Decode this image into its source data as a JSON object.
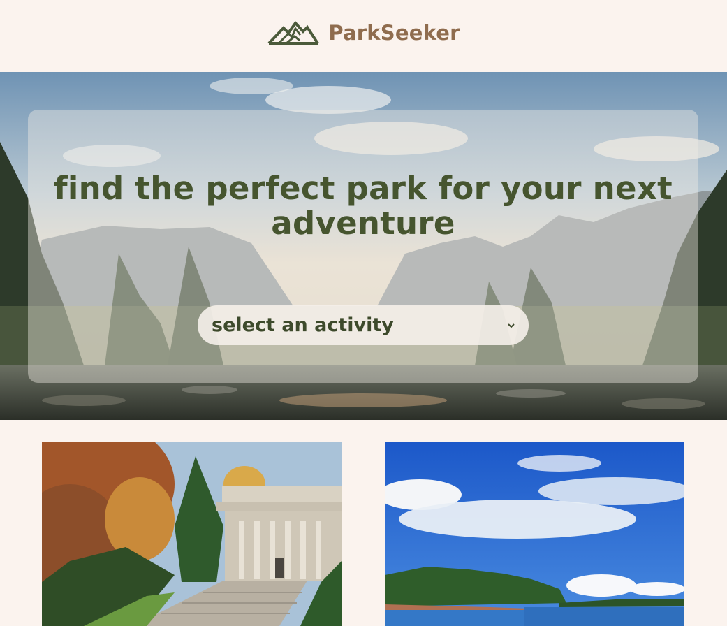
{
  "header": {
    "brand": "ParkSeeker",
    "logo_icon": "mountains-icon",
    "logo_color": "#4b5a3a",
    "brand_color": "#8f6c4e"
  },
  "hero": {
    "title": "find the perfect park for your next adventure",
    "select": {
      "selected": "select an activity",
      "icon": "chevron-down-icon"
    },
    "image": "valley-river-landscape"
  },
  "cards": [
    {
      "image": "memorial-building-autumn"
    },
    {
      "image": "coast-sky-clouds"
    }
  ],
  "colors": {
    "page_bg": "#fbf3ee",
    "title": "#46552f",
    "select_text": "#3d4a2b"
  }
}
